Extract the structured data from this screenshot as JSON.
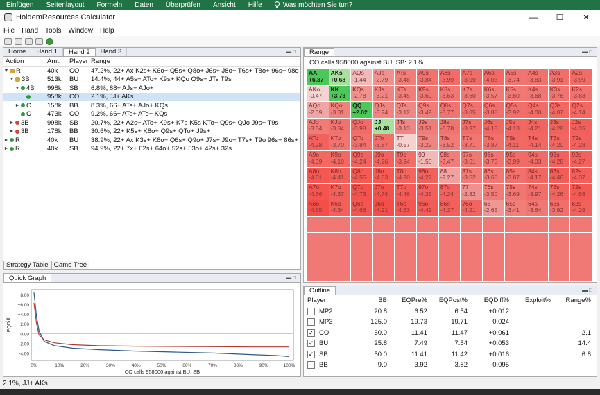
{
  "ribbon": {
    "tabs": [
      "Einfügen",
      "Seitenlayout",
      "Formeln",
      "Daten",
      "Überprüfen",
      "Ansicht",
      "Hilfe"
    ],
    "tell_me": "Was möchten Sie tun?"
  },
  "window": {
    "title": "HoldemResources Calculator"
  },
  "menu": [
    "File",
    "Hand",
    "Tools",
    "Window",
    "Help"
  ],
  "tabs": [
    "Home",
    "Hand 1",
    "Hand 2",
    "Hand 3"
  ],
  "tree": {
    "headers": [
      "Action",
      "Amt.",
      "Player",
      "Range"
    ],
    "rows": [
      {
        "action": "R",
        "amt": "40k",
        "player": "CO",
        "range": "47.2%, 22+ Ax K2s+ K6o+ Q5s+ Q8o+ J6s+ J8o+ T6s+ T8o+ 96s+ 98o 85s+"
      },
      {
        "action": "3B",
        "amt": "513k",
        "player": "BU",
        "range": "14.4%, 44+ A5s+ ATo+ K9s+ KQo Q9s+ JTs T9s"
      },
      {
        "action": "4B",
        "amt": "998k",
        "player": "SB",
        "range": "6.8%, 88+ AJs+ AJo+"
      },
      {
        "action": "",
        "amt": "958k",
        "player": "CO",
        "range": "2.1%, JJ+ AKs"
      },
      {
        "action": "C",
        "amt": "158k",
        "player": "BB",
        "range": "8.3%, 66+ ATs+ AJo+ KQs"
      },
      {
        "action": "C",
        "amt": "473k",
        "player": "CO",
        "range": "9.2%, 66+ ATs+ ATo+ KQs"
      },
      {
        "action": "3B",
        "amt": "998k",
        "player": "SB",
        "range": "20.7%, 22+ A2s+ ATo+ K9s+ K7s-K5s KTo+ Q9s+ QJo J9s+ T9s"
      },
      {
        "action": "3B",
        "amt": "178k",
        "player": "BB",
        "range": "30.6%, 22+ K5s+ K8o+ Q9s+ QTo+ J9s+"
      },
      {
        "action": "R",
        "amt": "40k",
        "player": "BU",
        "range": "38.9%, 22+ Ax K3s+ K8o+ Q6s+ Q9o+ J7s+ J9o+ T7s+ T9o 96s+ 86s+ 76s"
      },
      {
        "action": "R",
        "amt": "40k",
        "player": "SB",
        "range": "94.9%, 22+ 7x+ 62s+ 64o+ 52s+ 53o+ 42s+ 32s"
      }
    ],
    "bottom_tabs": [
      "Strategy Table",
      "Game Tree"
    ]
  },
  "range": {
    "panel_title": "Range",
    "title": "CO calls 958000 against BU, SB: 2.1%",
    "cells": [
      [
        "AA",
        "+6.37"
      ],
      [
        "AKs",
        "+0.68"
      ],
      [
        "AQs",
        "-1.44"
      ],
      [
        "AJs",
        "-2.79"
      ],
      [
        "ATs",
        "-3.48"
      ],
      [
        "A9s",
        "-3.84"
      ],
      [
        "A8s",
        "-3.99"
      ],
      [
        "A7s",
        "-3.99"
      ],
      [
        "A6s",
        "-4.03"
      ],
      [
        "A5s",
        "-3.74"
      ],
      [
        "A4s",
        "-3.83"
      ],
      [
        "A3s",
        "-3.91"
      ],
      [
        "A2s",
        "-3.99"
      ],
      [
        "AKo",
        "-0.47"
      ],
      [
        "KK",
        "+3.73"
      ],
      [
        "KQs",
        "-2.78"
      ],
      [
        "KJs",
        "-3.21"
      ],
      [
        "KTs",
        "-3.45"
      ],
      [
        "K9s",
        "-3.69"
      ],
      [
        "K8s",
        "-3.63"
      ],
      [
        "K7s",
        "-3.60"
      ],
      [
        "K6s",
        "-3.57"
      ],
      [
        "K5s",
        "-3.60"
      ],
      [
        "K4s",
        "-3.68"
      ],
      [
        "K3s",
        "-3.76"
      ],
      [
        "K2s",
        "-3.83"
      ],
      [
        "AQo",
        "-2.09"
      ],
      [
        "KQo",
        "-3.31"
      ],
      [
        "QQ",
        "+2.02"
      ],
      [
        "QJs",
        "-3.24"
      ],
      [
        "QTs",
        "-3.12"
      ],
      [
        "Q9s",
        "-3.49"
      ],
      [
        "Q8s",
        "-3.77"
      ],
      [
        "Q7s",
        "-3.85"
      ],
      [
        "Q6s",
        "-3.88"
      ],
      [
        "Q5s",
        "-3.92"
      ],
      [
        "Q4s",
        "-4.00"
      ],
      [
        "Q3s",
        "-4.07"
      ],
      [
        "Q2s",
        "-4.14"
      ],
      [
        "AJo",
        "-3.54"
      ],
      [
        "KJo",
        "-3.84"
      ],
      [
        "QJo",
        "-3.98"
      ],
      [
        "JJ",
        "+0.48"
      ],
      [
        "JTs",
        "-3.13"
      ],
      [
        "J9s",
        "-3.51"
      ],
      [
        "J8s",
        "-3.78"
      ],
      [
        "J7s",
        "-3.97"
      ],
      [
        "J6s",
        "-4.13"
      ],
      [
        "J5s",
        "-4.13"
      ],
      [
        "J4s",
        "-4.21"
      ],
      [
        "J3s",
        "-4.28"
      ],
      [
        "J2s",
        "-4.35"
      ],
      [
        "ATo",
        "-4.28"
      ],
      [
        "KTo",
        "-3.70"
      ],
      [
        "QTo",
        "-3.84"
      ],
      [
        "JTo",
        "-3.87"
      ],
      [
        "TT",
        "-0.57"
      ],
      [
        "T9s",
        "-3.22"
      ],
      [
        "T8s",
        "-3.52"
      ],
      [
        "T7s",
        "-3.71"
      ],
      [
        "T6s",
        "-3.87"
      ],
      [
        "T5s",
        "-4.11"
      ],
      [
        "T4s",
        "-4.14"
      ],
      [
        "T3s",
        "-4.20"
      ],
      [
        "T2s",
        "-4.28"
      ],
      [
        "A9o",
        "-4.09"
      ],
      [
        "K9o",
        "-4.10"
      ],
      [
        "Q9o",
        "-4.24"
      ],
      [
        "J9o",
        "-4.26"
      ],
      [
        "T9o",
        "-3.94"
      ],
      [
        "99",
        "-1.50"
      ],
      [
        "98s",
        "-3.47"
      ],
      [
        "97s",
        "-3.61"
      ],
      [
        "96s",
        "-3.73"
      ],
      [
        "95s",
        "-3.99"
      ],
      [
        "94s",
        "-4.03"
      ],
      [
        "93s",
        "-4.28"
      ],
      [
        "92s",
        "-4.27"
      ],
      [
        "A8o",
        "-4.61"
      ],
      [
        "K8o",
        "-4.41"
      ],
      [
        "Q8o",
        "-4.55"
      ],
      [
        "J8o",
        "-4.53"
      ],
      [
        "T8o",
        "-4.20"
      ],
      [
        "98o",
        "-4.27"
      ],
      [
        "88",
        "-2.27"
      ],
      [
        "87s",
        "-3.52"
      ],
      [
        "86s",
        "-3.65"
      ],
      [
        "85s",
        "-3.87"
      ],
      [
        "84s",
        "-4.17"
      ],
      [
        "83s",
        "-4.46"
      ],
      [
        "82s",
        "-4.37"
      ],
      [
        "A7o",
        "-4.66"
      ],
      [
        "K7o",
        "-4.37"
      ],
      [
        "Q7o",
        "-4.73"
      ],
      [
        "J7o",
        "-4.74"
      ],
      [
        "T7o",
        "-4.46"
      ],
      [
        "97o",
        "-4.35"
      ],
      [
        "87o",
        "-4.24"
      ],
      [
        "77",
        "-2.82"
      ],
      [
        "76s",
        "-3.50"
      ],
      [
        "75s",
        "-3.69"
      ],
      [
        "74s",
        "-3.97"
      ],
      [
        "73s",
        "-4.26"
      ],
      [
        "72s",
        "-4.56"
      ],
      [
        "A6o",
        "-4.85"
      ],
      [
        "K6o",
        "-4.34"
      ],
      [
        "Q6o",
        "-4.66"
      ],
      [
        "J6o",
        "-4.91"
      ],
      [
        "T6o",
        "-4.63"
      ],
      [
        "96o",
        "-4.49"
      ],
      [
        "86o",
        "-4.37"
      ],
      [
        "76o",
        "-4.21"
      ],
      [
        "66",
        "-2.65"
      ],
      [
        "65s",
        "-3.41"
      ],
      [
        "64s",
        "-3.64"
      ],
      [
        "63s",
        "-3.92"
      ],
      [
        "62s",
        "-4.29"
      ]
    ]
  },
  "quick_graph": {
    "panel_title": "Quick Graph",
    "xlabel": "CO calls 958000 against BU, SB",
    "ylabel": "EQDiff",
    "y_ticks": [
      "+8.00",
      "+6.00",
      "+4.00",
      "+2.00",
      "0.00",
      "-2.00",
      "-4.00"
    ],
    "x_ticks": [
      "0%",
      "10%",
      "20%",
      "30%",
      "40%",
      "50%",
      "60%",
      "70%",
      "80%",
      "90%",
      "100%"
    ]
  },
  "outline": {
    "panel_title": "Outline",
    "headers": [
      "Player",
      "BB",
      "EQPre%",
      "EQPost%",
      "EQDiff%",
      "Exploit%",
      "Range%"
    ],
    "rows": [
      {
        "checked": false,
        "player": "MP2",
        "bb": "20.8",
        "pre": "6.52",
        "post": "6.54",
        "diff": "+0.012",
        "exploit": "",
        "range": ""
      },
      {
        "checked": false,
        "player": "MP3",
        "bb": "125.0",
        "pre": "19.73",
        "post": "19.71",
        "diff": "-0.024",
        "exploit": "",
        "range": ""
      },
      {
        "checked": true,
        "player": "CO",
        "bb": "50.0",
        "pre": "11.41",
        "post": "11.47",
        "diff": "+0.061",
        "exploit": "",
        "range": "2.1"
      },
      {
        "checked": true,
        "player": "BU",
        "bb": "25.8",
        "pre": "7.49",
        "post": "7.54",
        "diff": "+0.053",
        "exploit": "",
        "range": "14.4"
      },
      {
        "checked": true,
        "player": "SB",
        "bb": "50.0",
        "pre": "11.41",
        "post": "11.42",
        "diff": "+0.016",
        "exploit": "",
        "range": "6.8"
      },
      {
        "checked": false,
        "player": "BB",
        "bb": "9.0",
        "pre": "3.92",
        "post": "3.82",
        "diff": "-0.095",
        "exploit": "",
        "range": ""
      }
    ]
  },
  "status": "2.1%, JJ+ AKs"
}
